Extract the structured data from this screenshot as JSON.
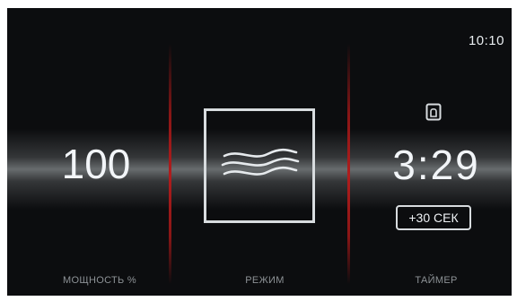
{
  "status": {
    "time": "10:10"
  },
  "power": {
    "value": "100",
    "label": "МОЩНОСТЬ %"
  },
  "mode": {
    "label": "РЕЖИМ",
    "icon": "wave-heat-icon"
  },
  "timer": {
    "value": "3:29",
    "label": "ТАЙМЕР",
    "add_button": "+30 СЕК",
    "door_icon": "door-lock-icon"
  },
  "colors": {
    "background": "#0c0d0f",
    "separator": "#b01d1d",
    "text": "#f2f5f8",
    "label": "#8d9296"
  }
}
